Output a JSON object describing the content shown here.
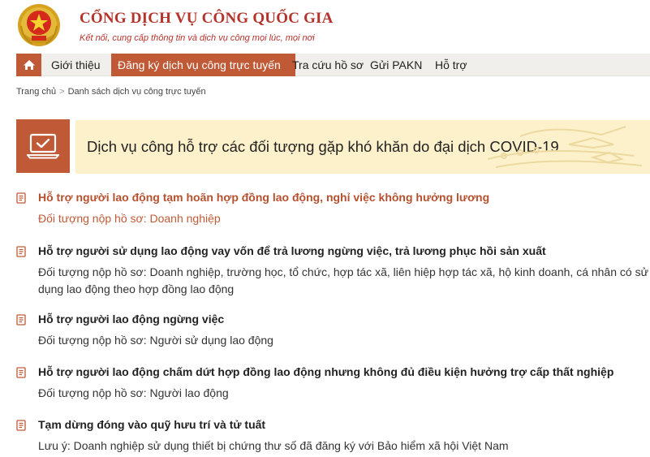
{
  "header": {
    "title": "CỔNG DỊCH VỤ CÔNG QUỐC GIA",
    "subtitle": "Kết nối, cung cấp thông tin và dịch vụ công mọi lúc, mọi nơi",
    "logo_icon": "national-emblem-icon"
  },
  "nav": {
    "home_icon": "home-icon",
    "items": [
      {
        "label": "Giới thiệu",
        "active": false
      },
      {
        "label": "Đăng ký dịch vụ công trực tuyến",
        "active": true
      },
      {
        "label": "Tra cứu hồ sơ",
        "active": false
      },
      {
        "label": "Gửi PAKN",
        "active": false
      },
      {
        "label": "Hỗ trợ",
        "active": false
      }
    ]
  },
  "breadcrumb": {
    "home": "Trang chủ",
    "separator": ">",
    "current": "Danh sách dịch vụ công trực tuyến"
  },
  "banner": {
    "icon": "laptop-check-icon",
    "title": "Dịch vụ công hỗ trợ các đối tượng gặp khó khăn do đại dịch COVID-19"
  },
  "services": [
    {
      "title": "Hỗ trợ người lao động tạm hoãn hợp đồng lao động, nghỉ việc không hưởng lương",
      "desc": "Đối tượng nộp hồ sơ: Doanh nghiệp",
      "highlight": true
    },
    {
      "title": "Hỗ trợ người sử dụng lao động vay vốn để trả lương ngừng việc, trả lương phục hồi sản xuất",
      "desc": "Đối tượng nộp hồ sơ: Doanh nghiệp, trường học, tổ chức, hợp tác xã, liên hiệp hợp tác xã, hộ kinh doanh, cá nhân có sử dụng lao động theo hợp đồng lao động",
      "highlight": false
    },
    {
      "title": "Hỗ trợ người lao động ngừng việc",
      "desc": "Đối tượng nộp hồ sơ: Người sử dụng lao động",
      "highlight": false
    },
    {
      "title": "Hỗ trợ người lao động chấm dứt hợp đồng lao động nhưng không đủ điều kiện hưởng trợ cấp thất nghiệp",
      "desc": "Đối tượng nộp hồ sơ: Người lao động",
      "highlight": false
    },
    {
      "title": "Tạm dừng đóng vào quỹ hưu trí và tử tuất",
      "desc": "Lưu ý: Doanh nghiệp sử dụng thiết bị chứng thư số đã đăng ký với Bảo hiểm xã hội Việt Nam",
      "highlight": false
    }
  ],
  "colors": {
    "brand_red": "#b5332a",
    "accent_orange": "#c05a36",
    "nav_bg": "#f0efeb",
    "banner_bg": "#fdf1cc"
  }
}
